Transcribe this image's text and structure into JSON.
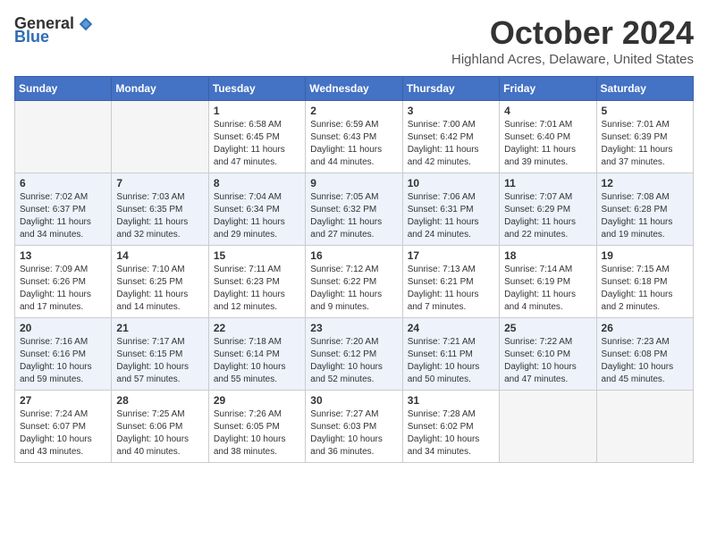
{
  "header": {
    "logo_general": "General",
    "logo_blue": "Blue",
    "month": "October 2024",
    "location": "Highland Acres, Delaware, United States"
  },
  "days_of_week": [
    "Sunday",
    "Monday",
    "Tuesday",
    "Wednesday",
    "Thursday",
    "Friday",
    "Saturday"
  ],
  "weeks": [
    [
      {
        "day": "",
        "info": ""
      },
      {
        "day": "",
        "info": ""
      },
      {
        "day": "1",
        "info": "Sunrise: 6:58 AM\nSunset: 6:45 PM\nDaylight: 11 hours and 47 minutes."
      },
      {
        "day": "2",
        "info": "Sunrise: 6:59 AM\nSunset: 6:43 PM\nDaylight: 11 hours and 44 minutes."
      },
      {
        "day": "3",
        "info": "Sunrise: 7:00 AM\nSunset: 6:42 PM\nDaylight: 11 hours and 42 minutes."
      },
      {
        "day": "4",
        "info": "Sunrise: 7:01 AM\nSunset: 6:40 PM\nDaylight: 11 hours and 39 minutes."
      },
      {
        "day": "5",
        "info": "Sunrise: 7:01 AM\nSunset: 6:39 PM\nDaylight: 11 hours and 37 minutes."
      }
    ],
    [
      {
        "day": "6",
        "info": "Sunrise: 7:02 AM\nSunset: 6:37 PM\nDaylight: 11 hours and 34 minutes."
      },
      {
        "day": "7",
        "info": "Sunrise: 7:03 AM\nSunset: 6:35 PM\nDaylight: 11 hours and 32 minutes."
      },
      {
        "day": "8",
        "info": "Sunrise: 7:04 AM\nSunset: 6:34 PM\nDaylight: 11 hours and 29 minutes."
      },
      {
        "day": "9",
        "info": "Sunrise: 7:05 AM\nSunset: 6:32 PM\nDaylight: 11 hours and 27 minutes."
      },
      {
        "day": "10",
        "info": "Sunrise: 7:06 AM\nSunset: 6:31 PM\nDaylight: 11 hours and 24 minutes."
      },
      {
        "day": "11",
        "info": "Sunrise: 7:07 AM\nSunset: 6:29 PM\nDaylight: 11 hours and 22 minutes."
      },
      {
        "day": "12",
        "info": "Sunrise: 7:08 AM\nSunset: 6:28 PM\nDaylight: 11 hours and 19 minutes."
      }
    ],
    [
      {
        "day": "13",
        "info": "Sunrise: 7:09 AM\nSunset: 6:26 PM\nDaylight: 11 hours and 17 minutes."
      },
      {
        "day": "14",
        "info": "Sunrise: 7:10 AM\nSunset: 6:25 PM\nDaylight: 11 hours and 14 minutes."
      },
      {
        "day": "15",
        "info": "Sunrise: 7:11 AM\nSunset: 6:23 PM\nDaylight: 11 hours and 12 minutes."
      },
      {
        "day": "16",
        "info": "Sunrise: 7:12 AM\nSunset: 6:22 PM\nDaylight: 11 hours and 9 minutes."
      },
      {
        "day": "17",
        "info": "Sunrise: 7:13 AM\nSunset: 6:21 PM\nDaylight: 11 hours and 7 minutes."
      },
      {
        "day": "18",
        "info": "Sunrise: 7:14 AM\nSunset: 6:19 PM\nDaylight: 11 hours and 4 minutes."
      },
      {
        "day": "19",
        "info": "Sunrise: 7:15 AM\nSunset: 6:18 PM\nDaylight: 11 hours and 2 minutes."
      }
    ],
    [
      {
        "day": "20",
        "info": "Sunrise: 7:16 AM\nSunset: 6:16 PM\nDaylight: 10 hours and 59 minutes."
      },
      {
        "day": "21",
        "info": "Sunrise: 7:17 AM\nSunset: 6:15 PM\nDaylight: 10 hours and 57 minutes."
      },
      {
        "day": "22",
        "info": "Sunrise: 7:18 AM\nSunset: 6:14 PM\nDaylight: 10 hours and 55 minutes."
      },
      {
        "day": "23",
        "info": "Sunrise: 7:20 AM\nSunset: 6:12 PM\nDaylight: 10 hours and 52 minutes."
      },
      {
        "day": "24",
        "info": "Sunrise: 7:21 AM\nSunset: 6:11 PM\nDaylight: 10 hours and 50 minutes."
      },
      {
        "day": "25",
        "info": "Sunrise: 7:22 AM\nSunset: 6:10 PM\nDaylight: 10 hours and 47 minutes."
      },
      {
        "day": "26",
        "info": "Sunrise: 7:23 AM\nSunset: 6:08 PM\nDaylight: 10 hours and 45 minutes."
      }
    ],
    [
      {
        "day": "27",
        "info": "Sunrise: 7:24 AM\nSunset: 6:07 PM\nDaylight: 10 hours and 43 minutes."
      },
      {
        "day": "28",
        "info": "Sunrise: 7:25 AM\nSunset: 6:06 PM\nDaylight: 10 hours and 40 minutes."
      },
      {
        "day": "29",
        "info": "Sunrise: 7:26 AM\nSunset: 6:05 PM\nDaylight: 10 hours and 38 minutes."
      },
      {
        "day": "30",
        "info": "Sunrise: 7:27 AM\nSunset: 6:03 PM\nDaylight: 10 hours and 36 minutes."
      },
      {
        "day": "31",
        "info": "Sunrise: 7:28 AM\nSunset: 6:02 PM\nDaylight: 10 hours and 34 minutes."
      },
      {
        "day": "",
        "info": ""
      },
      {
        "day": "",
        "info": ""
      }
    ]
  ]
}
